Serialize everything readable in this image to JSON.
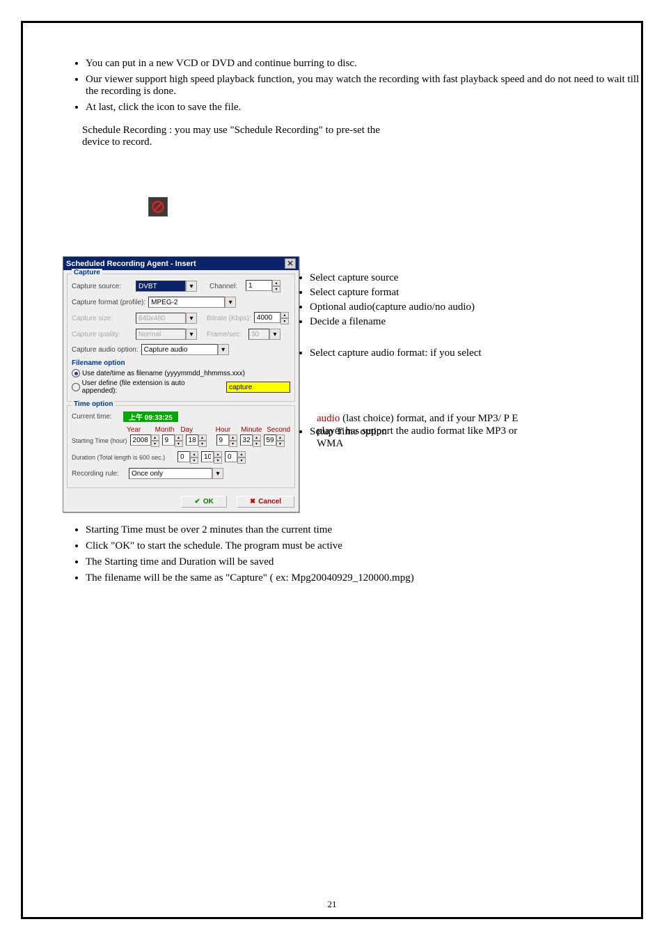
{
  "page_number": "21",
  "bullets_top": [
    "You can put in a new VCD or DVD and continue burring to disc.",
    "Our viewer support high speed playback function, you may watch the recording with fast playback speed and do not need to wait till the recording is done.",
    "At last, click the icon to save the file."
  ],
  "schedule_line": "Schedule Recording                  : you may use \"Schedule Recording\" to pre-set the",
  "schedule_line2": "device to record.",
  "bullets_right": [
    "Select capture source",
    "Select capture format",
    "Optional audio(capture audio/no audio)",
    "Decide a filename",
    "Select capture audio format: if you select",
    "Setup Time option"
  ],
  "rt_560": {
    "pre": "audio",
    "rest": "(last choice) format, and if your MP3/ P   E"
  },
  "rt_578": "player has support the audio format like MP3 or",
  "rt_596": "WMA",
  "bullets_bottom": [
    "Starting Time must be over 2 minutes than the current time",
    "Click \"OK\" to start the schedule. The program must be active",
    "The Starting time and Duration will be saved",
    "The filename will be the same as \"Capture\" ( ex: Mpg20040929_120000.mpg)"
  ],
  "dlg": {
    "title": "Scheduled Recording Agent - Insert",
    "capture": {
      "header": "Capture",
      "labels": {
        "source": "Capture source:",
        "channel": "Channel:",
        "profile": "Capture format (profile):",
        "size": "Capture size:",
        "bitrate": "Bitrate (Kbps):",
        "quality": "Capture quality:",
        "frames": "Frame/sec:",
        "audio": "Capture audio option:"
      },
      "vals": {
        "source": "DVBT",
        "channel": "1",
        "profile": "MPEG-2",
        "size": "640x480",
        "bitrate": "4000",
        "quality": "Normal",
        "frames": "30",
        "audio": "Capture audio"
      },
      "filename_header": "Filename option",
      "radio1": "Use date/time as filename (yyyymmdd_hhmmss.xxx)",
      "radio2": "User define (file extension is auto appended):",
      "userfile": "capture"
    },
    "time": {
      "header": "Time option",
      "cur_label": "Current time:",
      "cur_val": "上午 09:33:25",
      "cols": {
        "year": "Year",
        "month": "Month",
        "day": "Day",
        "hour": "Hour",
        "minute": "Minute",
        "second": "Second"
      },
      "start_label": "Starting Time (hour)",
      "vals": {
        "year": "2008",
        "month": "9",
        "day": "18",
        "hour": "9",
        "minute": "32",
        "second": "59"
      },
      "dur_label": "Duration (Total length is 600 sec.)",
      "dur": {
        "h": "0",
        "m": "10",
        "s": "0"
      },
      "rule_label": "Recording rule:",
      "rule_val": "Once only"
    },
    "ok": "OK",
    "cancel": "Cancel"
  }
}
